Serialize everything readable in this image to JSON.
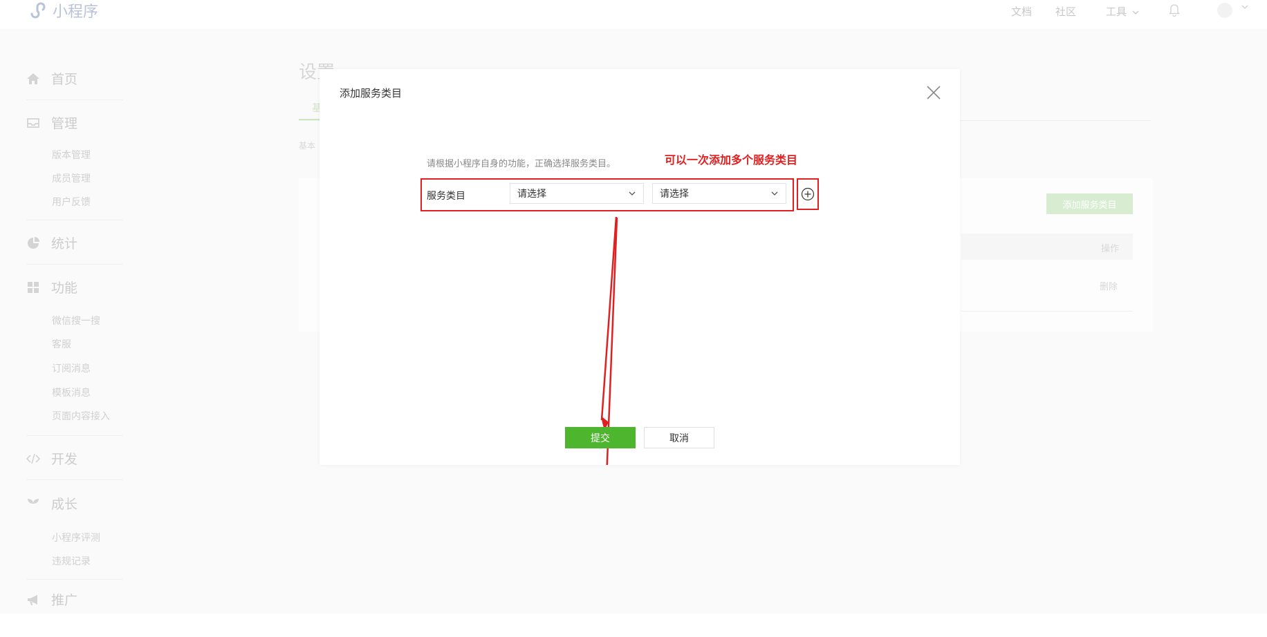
{
  "topbar": {
    "logo_text": "小程序",
    "links": [
      "文档",
      "社区",
      "工具"
    ],
    "tools_caret": "⌄"
  },
  "sidebar": {
    "groups": [
      {
        "label": "首页",
        "icon": "home-icon"
      },
      {
        "label": "管理",
        "icon": "inbox-icon",
        "items": [
          "版本管理",
          "成员管理",
          "用户反馈"
        ]
      },
      {
        "label": "统计",
        "icon": "pie-chart-icon"
      },
      {
        "label": "功能",
        "icon": "grid-icon",
        "items": [
          "微信搜一搜",
          "客服",
          "订阅消息",
          "模板消息",
          "页面内容接入"
        ]
      },
      {
        "label": "开发",
        "icon": "code-icon"
      },
      {
        "label": "成长",
        "icon": "sprout-icon",
        "items": [
          "小程序评测",
          "违规记录"
        ]
      },
      {
        "label": "推广",
        "icon": "megaphone-icon"
      }
    ]
  },
  "main": {
    "title": "设置",
    "tab_first_char": "基",
    "sub_text": "基本",
    "add_button": "添加服务类目",
    "column_action": "操作",
    "row_delete": "删除"
  },
  "modal": {
    "title": "添加服务类目",
    "description": "请根据小程序自身的功能，正确选择服务类目。",
    "annotation": "可以一次添加多个服务类目",
    "field_label": "服务类目",
    "select1_value": "请选择",
    "select2_value": "请选择",
    "submit": "提交",
    "cancel": "取消"
  },
  "colors": {
    "accent": "#4eb52f",
    "annotation_red": "#e02020",
    "muted_text": "#cccccc"
  }
}
